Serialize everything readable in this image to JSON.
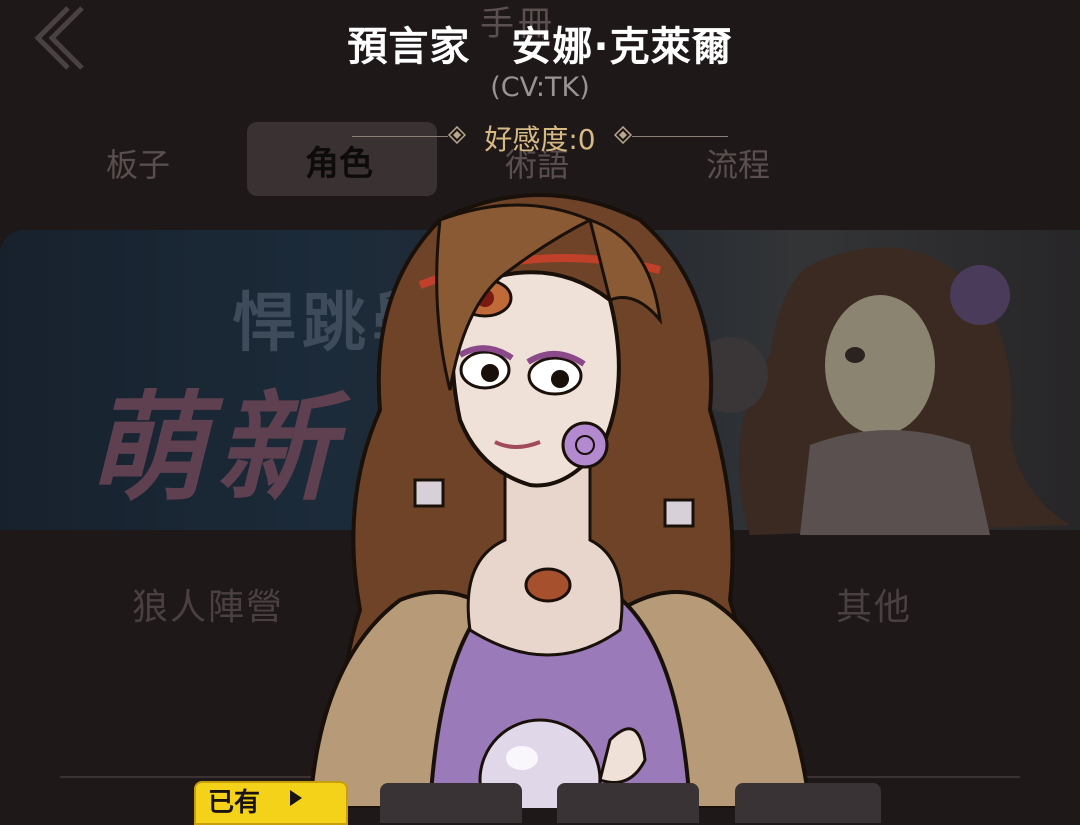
{
  "header": {
    "character_title": "預言家　安娜·克萊爾",
    "cv": "(CV:TK)",
    "affection": "好感度:0"
  },
  "background": {
    "title": "手冊",
    "tabs": [
      "板子",
      "角色",
      "術語",
      "流程"
    ],
    "active_tab": "角色",
    "banner_subtitle": "悍跳學",
    "banner_title": "萌新",
    "camps": [
      "狼人陣營",
      "其他"
    ]
  },
  "skins": {
    "owned_label": "已有"
  },
  "colors": {
    "accent_gold": "#d7b983",
    "badge_yellow": "#f4d21a",
    "dress_purple": "#9a7ab8",
    "hair_brown": "#7a4a2c"
  },
  "icons": [
    "back-chevron-icon",
    "diamond-icon",
    "arrow-right-icon"
  ]
}
